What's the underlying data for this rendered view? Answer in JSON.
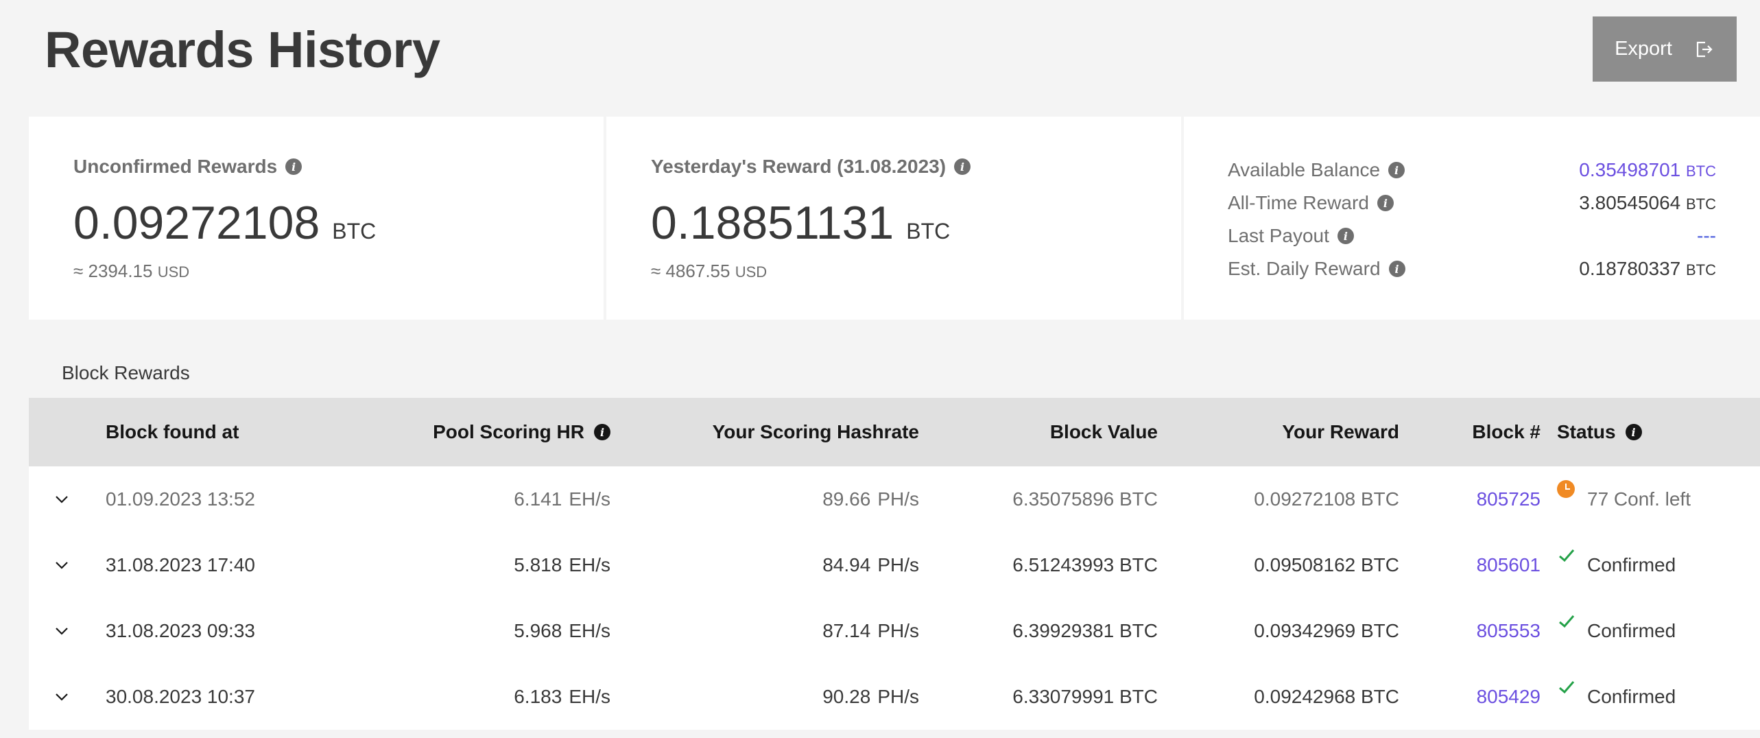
{
  "page": {
    "title": "Rewards History",
    "export_label": "Export"
  },
  "cards": {
    "unconfirmed": {
      "label": "Unconfirmed Rewards",
      "value": "0.09272108",
      "unit": "BTC",
      "approx": "≈ 2394.15",
      "approx_unit": "USD"
    },
    "yesterday": {
      "label": "Yesterday's Reward (31.08.2023)",
      "value": "0.18851131",
      "unit": "BTC",
      "approx": "≈ 4867.55",
      "approx_unit": "USD"
    },
    "balance": [
      {
        "label": "Available Balance",
        "value": "0.35498701",
        "unit": "BTC"
      },
      {
        "label": "All-Time Reward",
        "value": "3.80545064",
        "unit": "BTC"
      },
      {
        "label": "Last Payout",
        "value": "---",
        "unit": ""
      },
      {
        "label": "Est. Daily Reward",
        "value": "0.18780337",
        "unit": "BTC"
      }
    ]
  },
  "tabs": [
    {
      "label": "Block Rewards",
      "active": true
    }
  ],
  "table": {
    "headers": {
      "found_at": "Block found at",
      "pool_hr": "Pool Scoring HR",
      "your_hr": "Your Scoring Hashrate",
      "block_value": "Block Value",
      "your_reward": "Your Reward",
      "block_no": "Block #",
      "status": "Status"
    },
    "rows": [
      {
        "found_at": "01.09.2023 13:52",
        "pool_hr": "6.141",
        "pool_unit": "EH/s",
        "your_hr": "89.66",
        "your_unit": "PH/s",
        "block_value": "6.35075896 BTC",
        "your_reward": "0.09272108 BTC",
        "block_no": "805725",
        "status": "77 Conf. left",
        "status_icon": "clock-icon"
      },
      {
        "found_at": "31.08.2023 17:40",
        "pool_hr": "5.818",
        "pool_unit": "EH/s",
        "your_hr": "84.94",
        "your_unit": "PH/s",
        "block_value": "6.51243993 BTC",
        "your_reward": "0.09508162 BTC",
        "block_no": "805601",
        "status": "Confirmed",
        "status_icon": "check-icon"
      },
      {
        "found_at": "31.08.2023 09:33",
        "pool_hr": "5.968",
        "pool_unit": "EH/s",
        "your_hr": "87.14",
        "your_unit": "PH/s",
        "block_value": "6.39929381 BTC",
        "your_reward": "0.09342969 BTC",
        "block_no": "805553",
        "status": "Confirmed",
        "status_icon": "check-icon"
      },
      {
        "found_at": "30.08.2023 10:37",
        "pool_hr": "6.183",
        "pool_unit": "EH/s",
        "your_hr": "90.28",
        "your_unit": "PH/s",
        "block_value": "6.33079991 BTC",
        "your_reward": "0.09242968 BTC",
        "block_no": "805429",
        "status": "Confirmed",
        "status_icon": "check-icon"
      }
    ]
  },
  "colors": {
    "accent": "#6b4fe0",
    "pending": "#f08a24",
    "confirmed": "#24a148",
    "export_bg": "#8d8d8d"
  }
}
